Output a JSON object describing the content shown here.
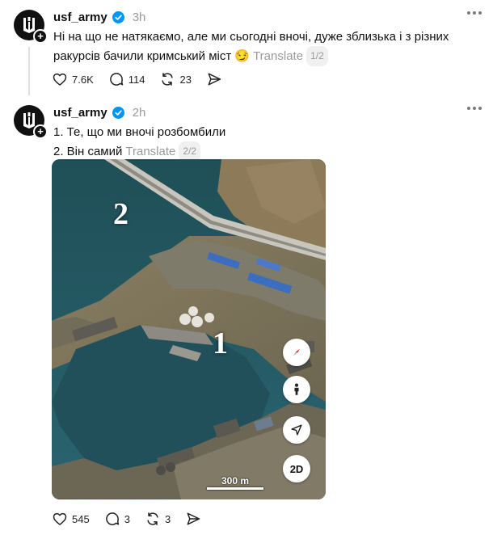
{
  "colors": {
    "verified_blue": "#0095f6",
    "text_primary": "#101010",
    "text_secondary": "#9a9a9a"
  },
  "icons": {
    "avatar": "ukraine-trident-icon",
    "verified": "verified-badge-icon",
    "more": "more-horizontal-icon",
    "like": "heart-icon",
    "comment": "comment-bubble-icon",
    "repost": "repost-icon",
    "share": "send-icon",
    "compass": "compass-icon",
    "street_view": "person-icon",
    "locate": "navigation-arrow-icon"
  },
  "posts": [
    {
      "username": "usf_army",
      "time": "3h",
      "text": "Ні на що не натякаємо, але ми сьогодні вночі, дуже зблизька і з різних ракурсів бачили кримський міст 😏",
      "translate_label": "Translate",
      "pager": "1/2",
      "likes": "7.6K",
      "comments": "114",
      "reposts": "23"
    },
    {
      "username": "usf_army",
      "time": "2h",
      "line1": "1. Те, що ми вночі розбомбили",
      "line2": "2. Він самий",
      "translate_label": "Translate",
      "pager": "2/2",
      "likes": "545",
      "comments": "3",
      "reposts": "3",
      "map": {
        "label_one": "1",
        "label_two": "2",
        "mode_button": "2D",
        "scale_text": "300 m"
      }
    }
  ]
}
